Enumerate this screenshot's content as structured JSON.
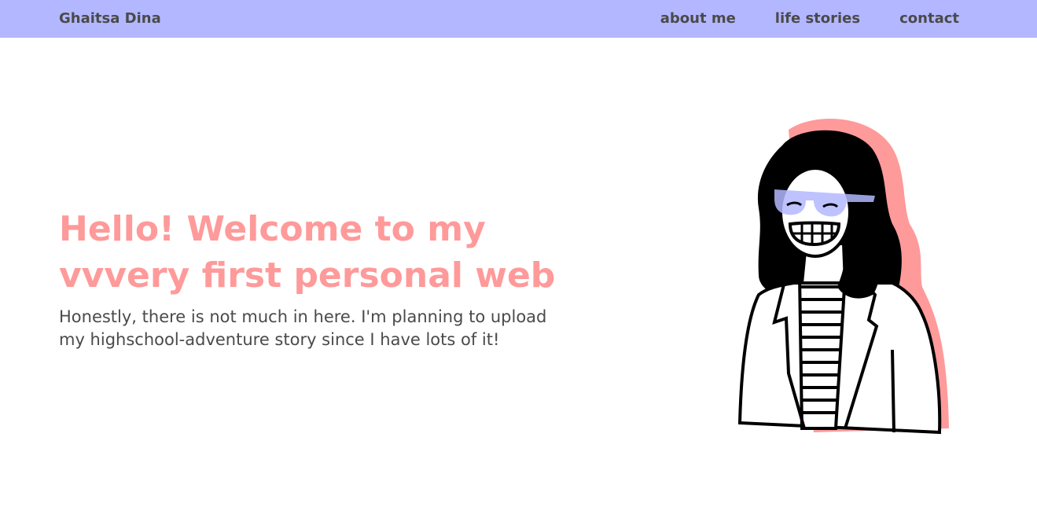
{
  "navbar": {
    "brand": "Ghaitsa Dina",
    "links": [
      "about me",
      "life stories",
      "contact"
    ],
    "background": "#b3b7ff"
  },
  "hero": {
    "title_lines": [
      "Hello! Welcome to my",
      "vvvery first personal web"
    ],
    "subtitle_lines": [
      "Honestly, there is not much in here. I'm planning to upload",
      "my highschool-adventure story since I have lots of it!"
    ],
    "title_color": "#ff9a9a",
    "text_color": "#4a4a4a"
  },
  "illustration": {
    "icon": "girl-with-glasses-illustration",
    "shadow_color": "#ff9a9a",
    "glasses_color": "#b3b7ff"
  }
}
